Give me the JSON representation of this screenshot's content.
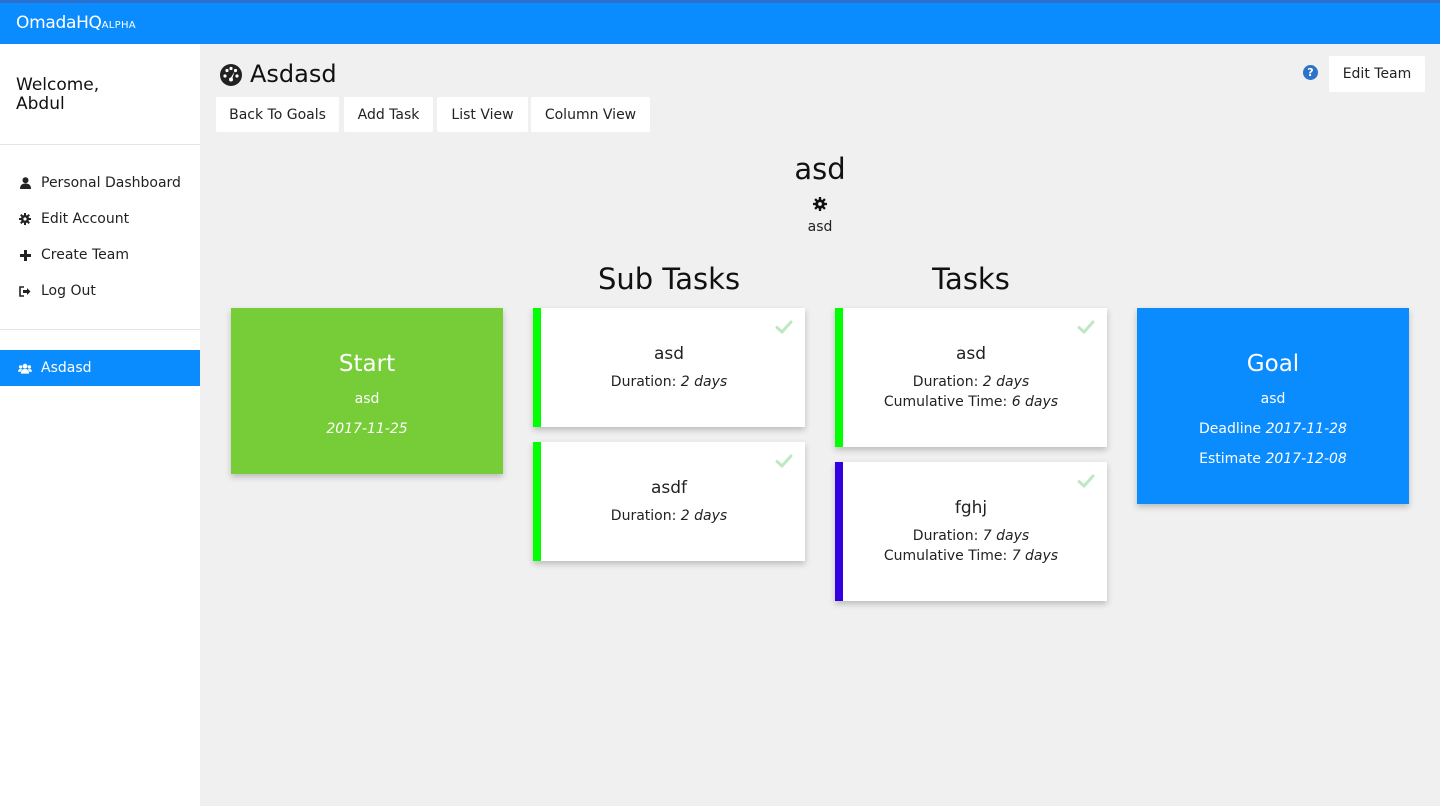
{
  "app": {
    "brand": "OmadaHQ",
    "brand_tag": "ALPHA"
  },
  "sidebar": {
    "welcome_line1": "Welcome,",
    "welcome_line2": "Abdul",
    "items": [
      {
        "label": "Personal Dashboard",
        "icon": "user-icon"
      },
      {
        "label": "Edit Account",
        "icon": "gear-icon"
      },
      {
        "label": "Create Team",
        "icon": "plus-icon"
      },
      {
        "label": "Log Out",
        "icon": "sign-out-icon"
      }
    ],
    "teams": [
      {
        "label": "Asdasd",
        "icon": "users-icon",
        "active": true
      }
    ]
  },
  "header": {
    "title": "Asdasd",
    "title_icon": "dashboard-icon",
    "help_icon": "question-circle-icon",
    "edit_team_label": "Edit Team"
  },
  "toolbar": {
    "back_label": "Back To Goals",
    "add_task_label": "Add Task",
    "list_view_label": "List View",
    "column_view_label": "Column View"
  },
  "goal": {
    "name": "asd",
    "description": "asd"
  },
  "columns": {
    "subtasks_title": "Sub Tasks",
    "tasks_title": "Tasks"
  },
  "start_card": {
    "title": "Start",
    "description": "asd",
    "date": "2017-11-25",
    "color": "#76cd37"
  },
  "goal_card": {
    "title": "Goal",
    "description": "asd",
    "deadline_label": "Deadline",
    "deadline": "2017-11-28",
    "estimate_label": "Estimate",
    "estimate": "2017-12-08",
    "color": "#0a8cff"
  },
  "labels": {
    "duration": "Duration:",
    "cumulative": "Cumulative Time:"
  },
  "subtasks": [
    {
      "name": "asd",
      "duration": "2 days",
      "bar_color": "#00ff00"
    },
    {
      "name": "asdf",
      "duration": "2 days",
      "bar_color": "#00ff00"
    }
  ],
  "tasks": [
    {
      "name": "asd",
      "duration": "2 days",
      "cumulative": "6 days",
      "bar_color": "#00ff00"
    },
    {
      "name": "fghj",
      "duration": "7 days",
      "cumulative": "7 days",
      "bar_color": "#3300e0"
    }
  ]
}
